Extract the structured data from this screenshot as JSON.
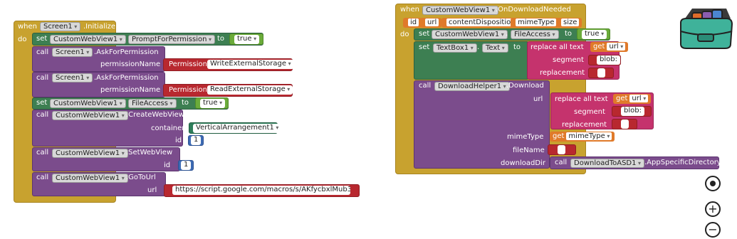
{
  "init": {
    "when": "when",
    "component": "Screen1",
    "event": ".Initialize",
    "do": "do",
    "set": "set",
    "call": "call",
    "to": "to",
    "webview": "CustomWebView1",
    "dot": ".",
    "prompt_prop": "PromptForPermission",
    "true1": "true",
    "screen": "Screen1",
    "ask": ".AskForPermission",
    "perm_name": "permissionName",
    "permission": "Permission",
    "perm_write": "WriteExternalStorage",
    "perm_read": "ReadExternalStorage",
    "file_access": "FileAccess",
    "true2": "true",
    "create": ".CreateWebView",
    "container": "container",
    "arrangement": "VerticalArrangement1",
    "id": "id",
    "num1": "1",
    "setwebview": ".SetWebView",
    "num2": "1",
    "gotourl": ".GoToUrl",
    "url": "url",
    "url_value": "https://script.google.com/macros/s/AKfycbxlMub33..."
  },
  "download": {
    "when": "when",
    "component": "CustomWebView1",
    "event": ".OnDownloadNeeded",
    "params": [
      "id",
      "url",
      "contentDisposition",
      "mimeType",
      "size"
    ],
    "do": "do",
    "set": "set",
    "to": "to",
    "webview": "CustomWebView1",
    "dot": ".",
    "file_access": "FileAccess",
    "true": "true",
    "textbox": "TextBox1",
    "text_prop": "Text",
    "replace_all": "replace all text",
    "get": "get",
    "get_url": "url",
    "segment": "segment",
    "blob": "blob:",
    "replacement": "replacement",
    "call": "call",
    "helper": "DownloadHelper1",
    "download_method": ".Download",
    "url_label": "url",
    "mime_label": "mimeType",
    "get_mime": "mimeType",
    "filename_label": "fileName",
    "downloaddir_label": "downloadDir",
    "asd": "DownloadToASD1",
    "asd_method": ".AppSpecificDirectory"
  },
  "controls": {
    "target_icon": "target-icon",
    "zoom_in_icon": "plus-icon",
    "zoom_out_icon": "minus-icon"
  }
}
